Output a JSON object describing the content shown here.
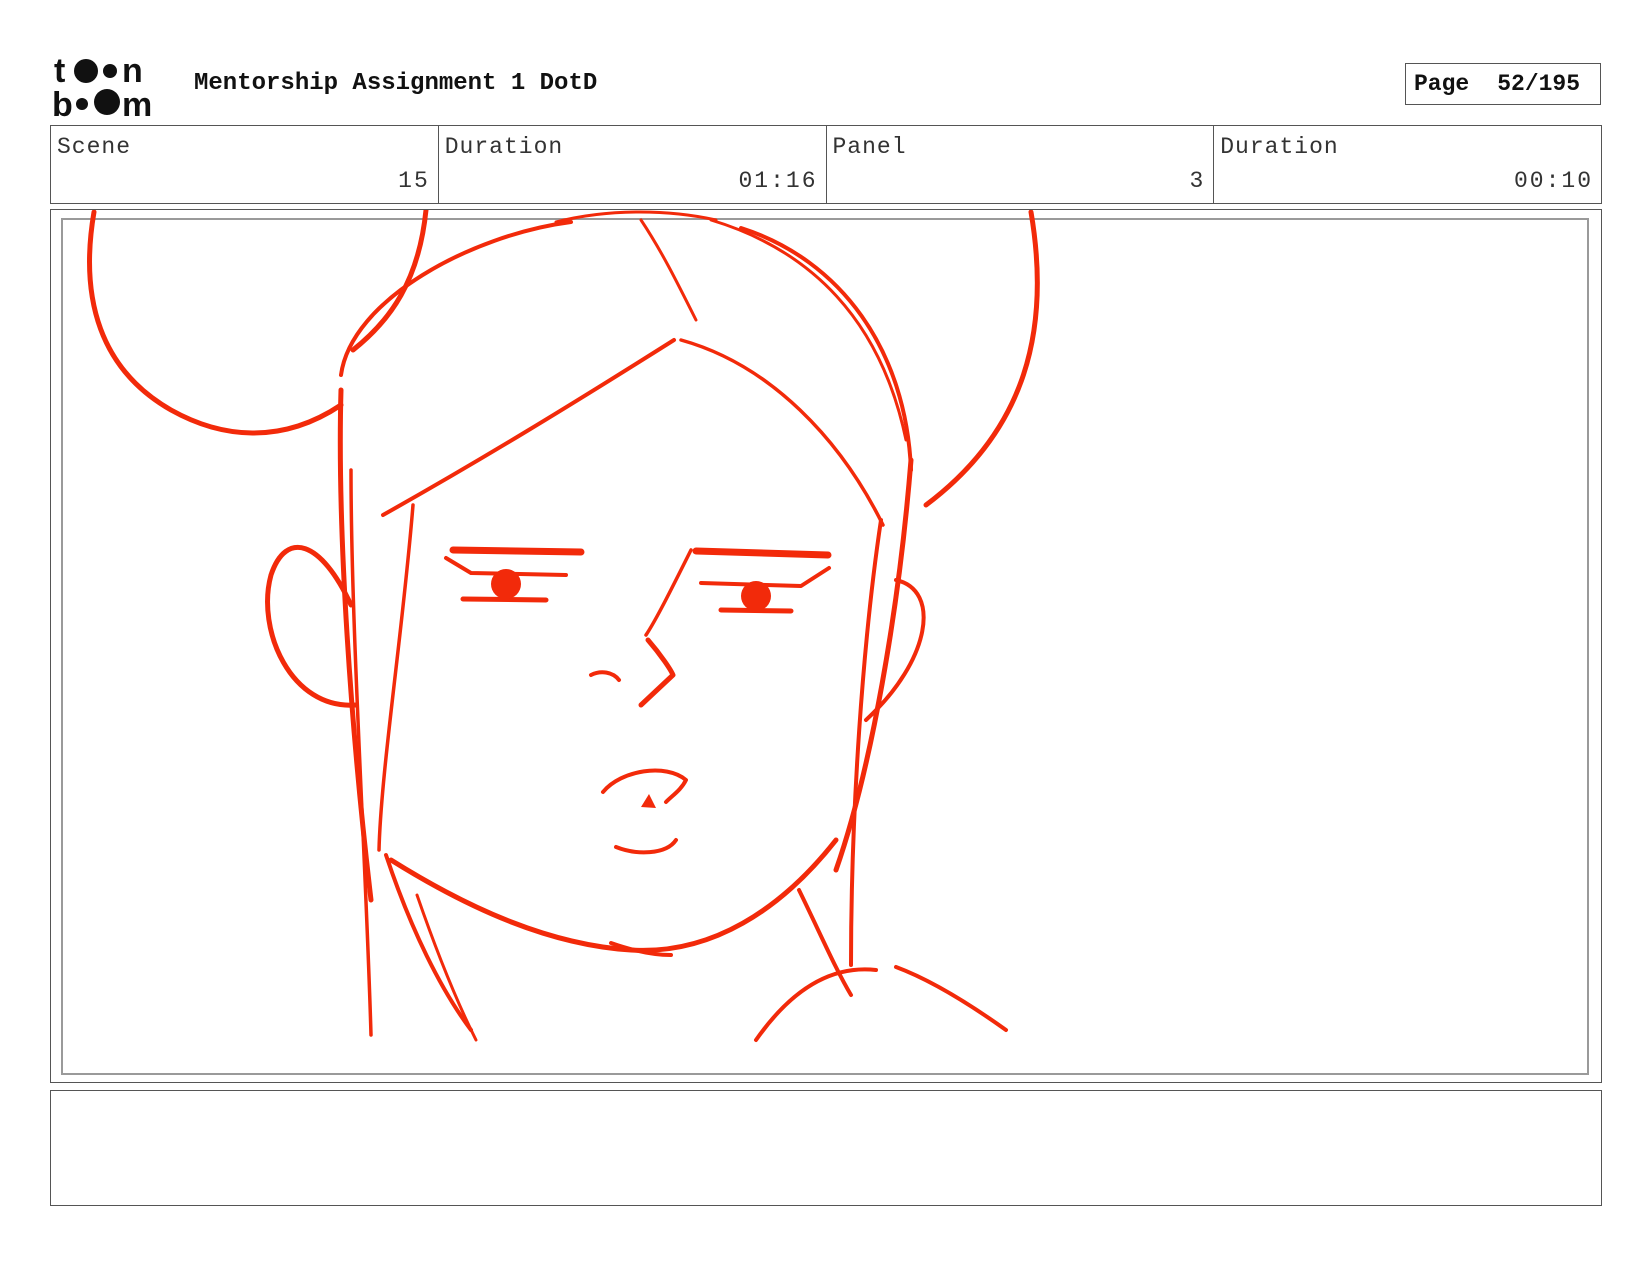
{
  "header": {
    "logo_name": "toon-boom-logo",
    "title": "Mentorship Assignment 1 DotD",
    "page_label": "Page",
    "page_value": "52/195"
  },
  "info": {
    "scene_label": "Scene",
    "scene_value": "15",
    "scene_duration_label": "Duration",
    "scene_duration_value": "01:16",
    "panel_label": "Panel",
    "panel_value": "3",
    "panel_duration_label": "Duration",
    "panel_duration_value": "00:10"
  },
  "colors": {
    "sketch": "#f22a0a",
    "border": "#555555",
    "safe_area": "#9a9a9a"
  },
  "notes": {
    "text": ""
  }
}
